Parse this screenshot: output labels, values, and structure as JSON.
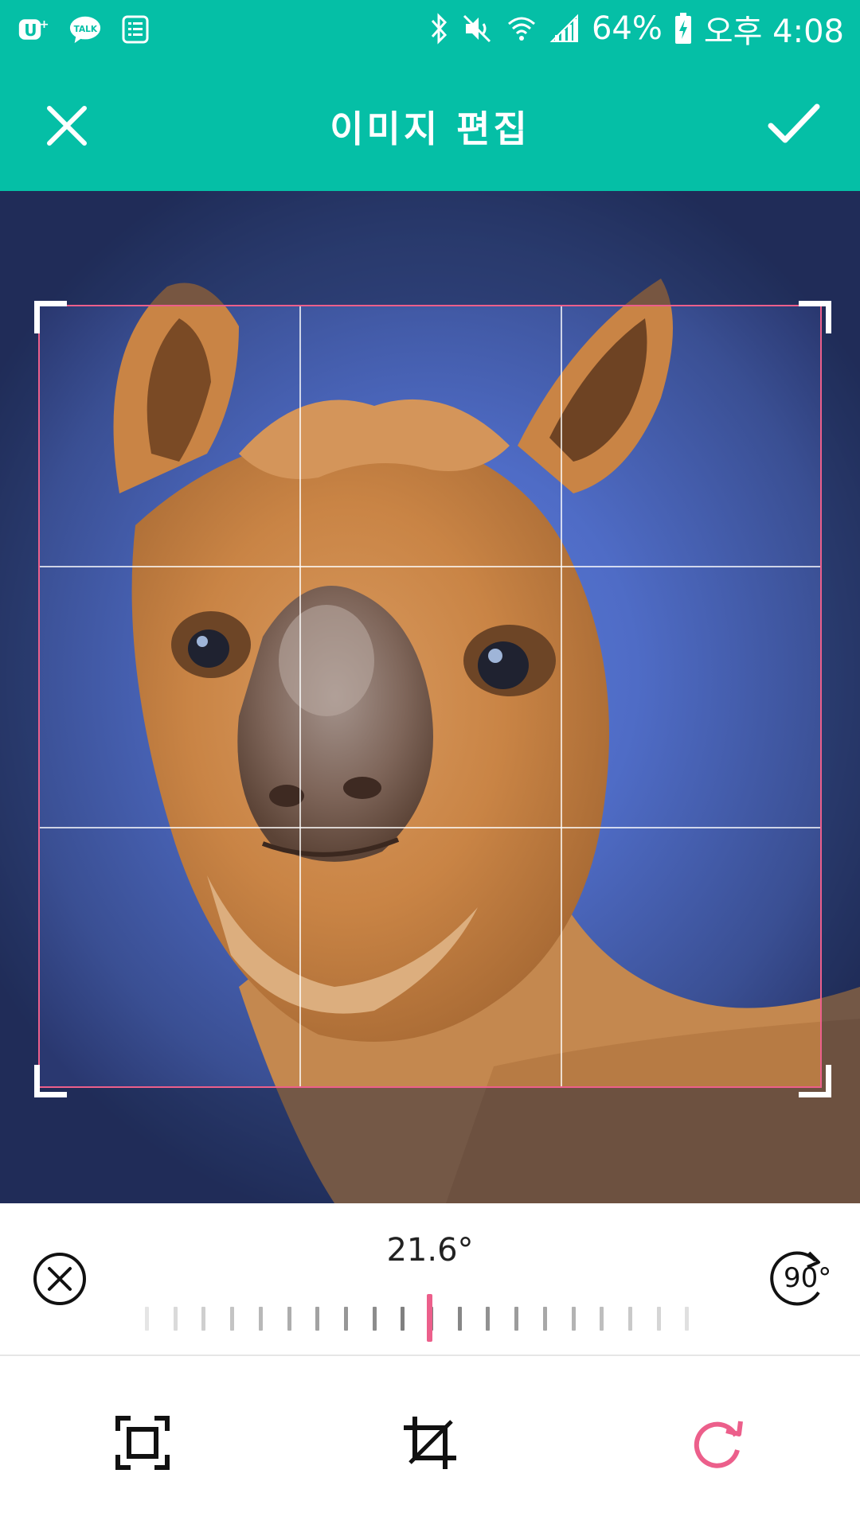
{
  "status_bar": {
    "battery": "64%",
    "time": "오후 4:08",
    "icons": [
      "uplus-icon",
      "kakaotalk-icon",
      "notes-icon",
      "bluetooth-icon",
      "mute-icon",
      "wifi-icon",
      "signal-icon",
      "battery-charging-icon"
    ],
    "talk_label": "TALK"
  },
  "app_bar": {
    "title": "이미지 편집",
    "close_icon": "close-icon",
    "confirm_icon": "check-icon"
  },
  "editor": {
    "rotation_angle": "21.6°",
    "rotate_90_label": "90°",
    "reset_icon": "reset-circle-x-icon"
  },
  "toolbar": {
    "tools": [
      {
        "name": "aspect-ratio",
        "icon": "frame-icon",
        "active": false
      },
      {
        "name": "crop",
        "icon": "crop-icon",
        "active": false
      },
      {
        "name": "rotate",
        "icon": "rotate-icon",
        "active": true
      }
    ]
  },
  "colors": {
    "accent_teal": "#05bfa6",
    "active_pink": "#ec5f8b"
  }
}
